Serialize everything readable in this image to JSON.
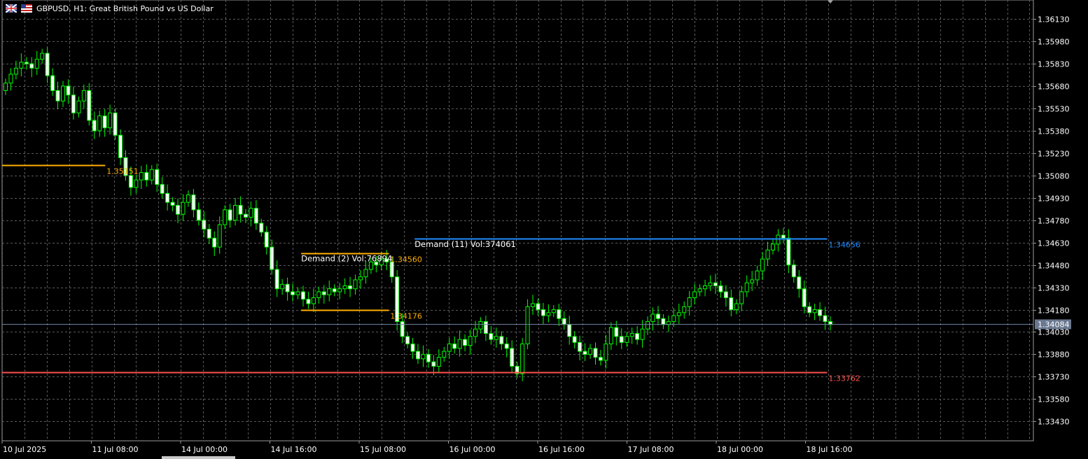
{
  "window": {
    "title": "GBPUSD, H1:  Great British Pound vs US Dollar",
    "icons": [
      "uk-flag-icon",
      "us-flag-icon"
    ]
  },
  "colors": {
    "background": "#000000",
    "grid": "#5a5a5a",
    "candle_bull_fill": "#ffffff",
    "candle_outline": "#00ff00",
    "supply_line": "#ffb000",
    "demand_line": "#1e8cff",
    "support_line": "#ff5050",
    "price_line": "#7080a0",
    "axis_text": "#ffffff"
  },
  "chart_data": {
    "type": "candlestick",
    "symbol": "GBPUSD",
    "timeframe": "H1",
    "ylim": [
      1.333,
      1.3622
    ],
    "y_ticks": [
      "1.36130",
      "1.35980",
      "1.35830",
      "1.35680",
      "1.35530",
      "1.35380",
      "1.35230",
      "1.35080",
      "1.34930",
      "1.34780",
      "1.34630",
      "1.34480",
      "1.34330",
      "1.34180",
      "1.34030",
      "1.33880",
      "1.33730",
      "1.33580",
      "1.33430"
    ],
    "x_ticks": [
      "10 Jul 2025",
      "11 Jul 08:00",
      "14 Jul 00:00",
      "14 Jul 16:00",
      "15 Jul 08:00",
      "16 Jul 00:00",
      "16 Jul 16:00",
      "17 Jul 08:00",
      "18 Jul 00:00",
      "18 Jul 16:00"
    ],
    "current_price": "1.34084",
    "levels": [
      {
        "label": "1.35151",
        "price": 1.35151,
        "color": "#ffb000",
        "x_start": 0,
        "x_end": 0.1
      },
      {
        "label": "1.34560",
        "price": 1.3456,
        "color": "#ffb000",
        "x_start": 0.29,
        "x_end": 0.375
      },
      {
        "label": "1.34176",
        "price": 1.34176,
        "color": "#ffb000",
        "x_start": 0.29,
        "x_end": 0.375
      },
      {
        "label": "1.34656",
        "price": 1.34656,
        "color": "#1e8cff",
        "x_start": 0.4,
        "x_end": 0.8
      },
      {
        "label": "1.33762",
        "price": 1.33762,
        "color": "#ff5050",
        "x_start": 0,
        "x_end": 0.8
      }
    ],
    "zone_labels": [
      {
        "text": "Demand (2) Vol:76894",
        "price": 1.3456,
        "x_start": 0.29
      },
      {
        "text": "Demand (11) Vol:374061",
        "price": 1.34656,
        "x_start": 0.4
      }
    ],
    "closes": [
      1.357,
      1.3576,
      1.358,
      1.3584,
      1.3583,
      1.358,
      1.3586,
      1.359,
      1.3575,
      1.3565,
      1.3558,
      1.3568,
      1.3562,
      1.355,
      1.3558,
      1.3565,
      1.3545,
      1.3538,
      1.3548,
      1.354,
      1.355,
      1.3535,
      1.352,
      1.3508,
      1.35,
      1.3505,
      1.351,
      1.3505,
      1.3512,
      1.3502,
      1.3496,
      1.349,
      1.3488,
      1.3482,
      1.349,
      1.3495,
      1.3485,
      1.3478,
      1.3472,
      1.3466,
      1.346,
      1.3475,
      1.3485,
      1.3478,
      1.3488,
      1.3482,
      1.348,
      1.3486,
      1.3476,
      1.347,
      1.346,
      1.3445,
      1.3432,
      1.3435,
      1.343,
      1.3428,
      1.343,
      1.3425,
      1.3422,
      1.3426,
      1.343,
      1.3428,
      1.3432,
      1.343,
      1.3432,
      1.3434,
      1.3432,
      1.3438,
      1.344,
      1.3445,
      1.345,
      1.3448,
      1.3452,
      1.345,
      1.344,
      1.341,
      1.34,
      1.3395,
      1.339,
      1.3385,
      1.3388,
      1.3383,
      1.338,
      1.3386,
      1.339,
      1.3395,
      1.3392,
      1.3398,
      1.3394,
      1.34,
      1.3405,
      1.341,
      1.3402,
      1.3398,
      1.34,
      1.3395,
      1.3392,
      1.338,
      1.3375,
      1.3395,
      1.342,
      1.3422,
      1.3418,
      1.3414,
      1.3416,
      1.3418,
      1.3412,
      1.3408,
      1.34,
      1.3396,
      1.339,
      1.3388,
      1.3392,
      1.3386,
      1.3384,
      1.3395,
      1.3406,
      1.34,
      1.3396,
      1.34,
      1.3402,
      1.3398,
      1.3405,
      1.341,
      1.3415,
      1.3412,
      1.3408,
      1.341,
      1.3414,
      1.3416,
      1.342,
      1.3426,
      1.343,
      1.3432,
      1.3434,
      1.3436,
      1.3434,
      1.343,
      1.3426,
      1.3418,
      1.3422,
      1.343,
      1.3436,
      1.3438,
      1.3444,
      1.3452,
      1.3458,
      1.3462,
      1.3468,
      1.3466,
      1.3448,
      1.344,
      1.3432,
      1.342,
      1.3416,
      1.3418,
      1.3414,
      1.341,
      1.3408
    ]
  }
}
